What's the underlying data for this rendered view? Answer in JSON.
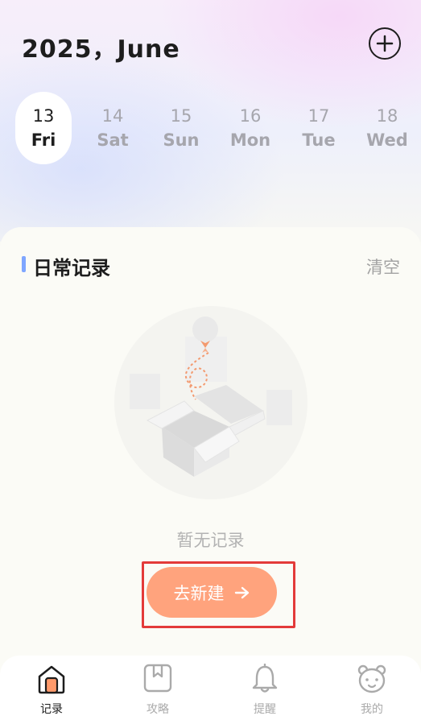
{
  "header": {
    "title": "2025，June",
    "add_icon": "plus-circle-icon"
  },
  "dates": [
    {
      "num": "13",
      "day": "Fri",
      "active": true
    },
    {
      "num": "14",
      "day": "Sat",
      "active": false
    },
    {
      "num": "15",
      "day": "Sun",
      "active": false
    },
    {
      "num": "16",
      "day": "Mon",
      "active": false
    },
    {
      "num": "17",
      "day": "Tue",
      "active": false
    },
    {
      "num": "18",
      "day": "Wed",
      "active": false
    }
  ],
  "section": {
    "title": "日常记录",
    "clear_label": "清空"
  },
  "empty_state": {
    "illustration": "empty-box-illustration",
    "text": "暂无记录",
    "button_label": "去新建",
    "button_icon": "arrow-right-icon"
  },
  "tabbar": {
    "items": [
      {
        "label": "记录",
        "icon": "house-icon",
        "active": true
      },
      {
        "label": "攻略",
        "icon": "bookmark-book-icon",
        "active": false
      },
      {
        "label": "提醒",
        "icon": "bell-icon",
        "active": false
      },
      {
        "label": "我的",
        "icon": "bear-face-icon",
        "active": false
      }
    ]
  },
  "colors": {
    "accent_orange": "#ffa37d",
    "section_bar_blue": "#7fa6ff",
    "highlight_red": "#e33a3a"
  }
}
